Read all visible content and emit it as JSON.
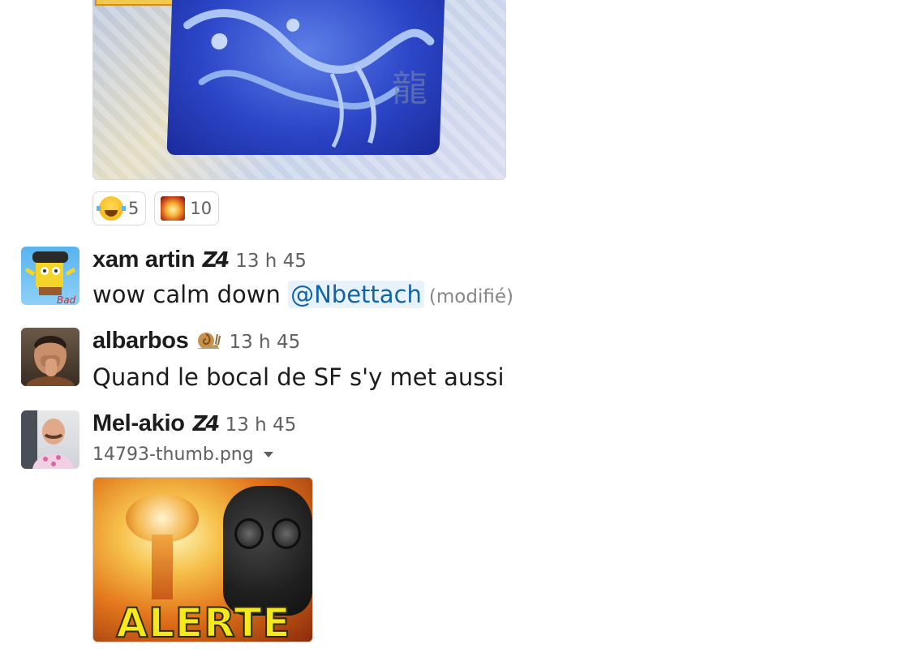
{
  "top_attachment": {
    "kanji": "龍"
  },
  "reactions": [
    {
      "emoji": "joy-emoji",
      "count": "5"
    },
    {
      "emoji": "explosion-emoji",
      "count": "10"
    }
  ],
  "messages": [
    {
      "username": "xam artin",
      "status_icon": "Z4",
      "timestamp": "13 h 45",
      "text_before": "wow calm down ",
      "mention": "@Nbettach",
      "edited": "(modifié)"
    },
    {
      "username": "albarbos",
      "status_icon": "snail-icon",
      "timestamp": "13 h 45",
      "text": "Quand le bocal de SF s'y met aussi"
    },
    {
      "username": "Mel-akio",
      "status_icon": "Z4",
      "timestamp": "13 h 45",
      "file_name": "14793-thumb.png",
      "image_caption": "ALERTE"
    }
  ]
}
